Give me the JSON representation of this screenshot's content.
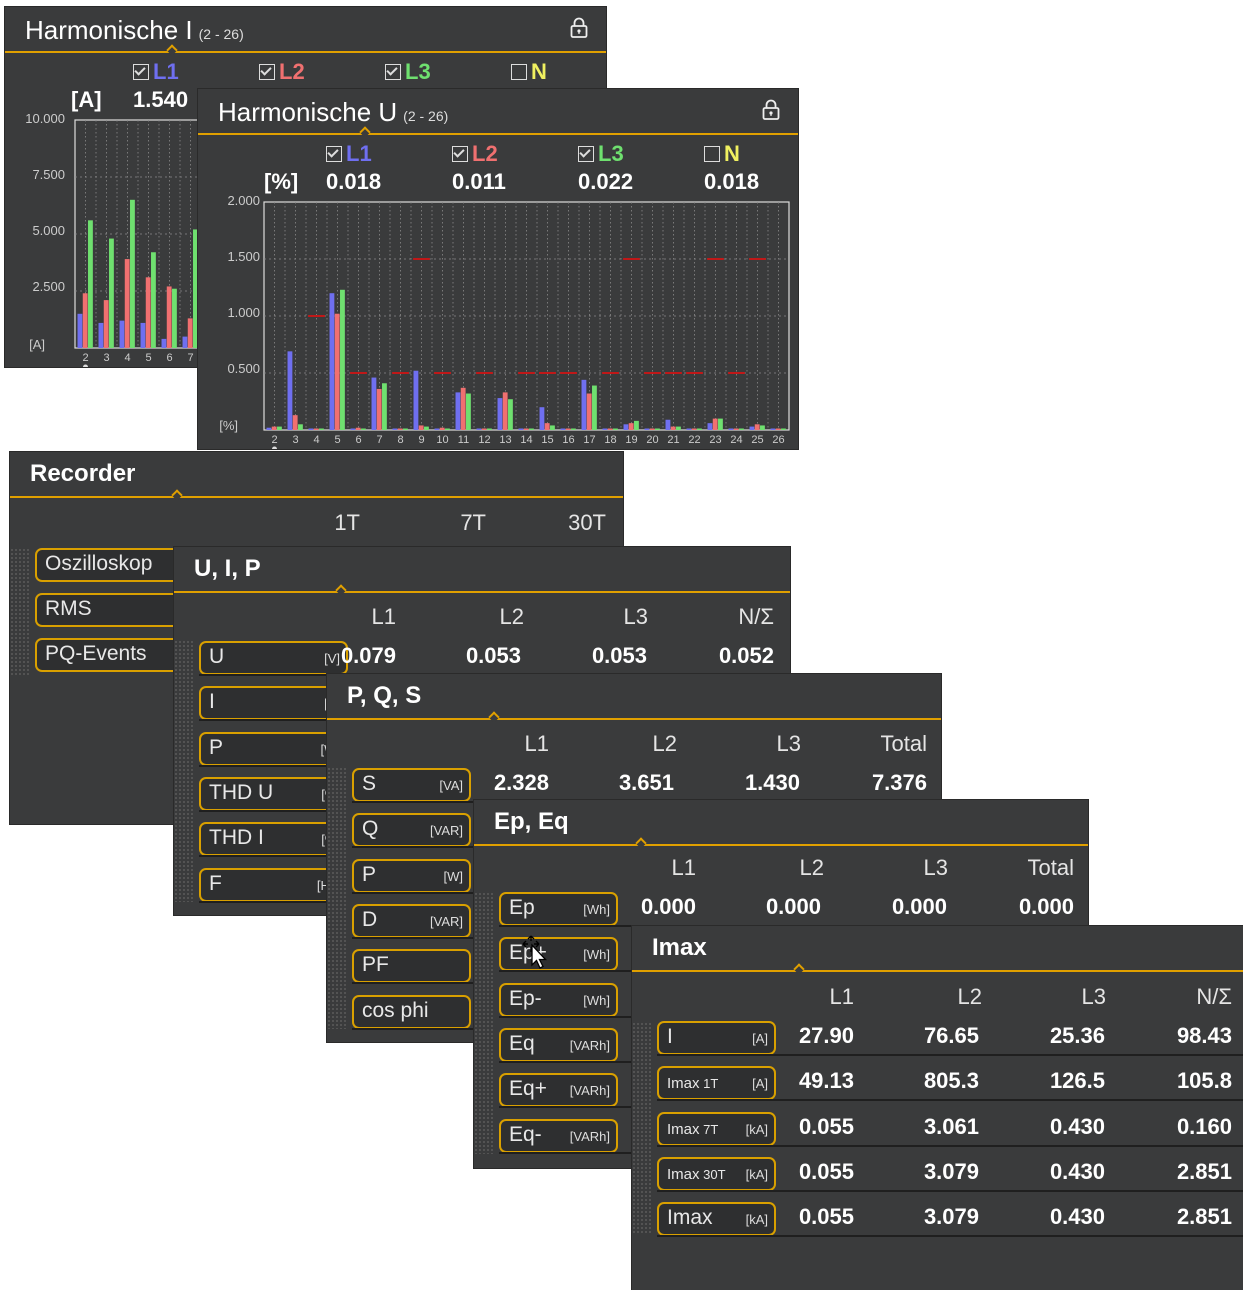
{
  "colors": {
    "L1": "#6f6ff0",
    "L2": "#f07070",
    "L3": "#6fe06f",
    "N": "#f0f060",
    "accent": "#e0a000",
    "limit": "#c01818"
  },
  "harm_i": {
    "title": "Harmonische I",
    "range": "(2 - 26)",
    "unit": "[A]",
    "channels": [
      {
        "name": "L1",
        "checked": true,
        "value": "1.540"
      },
      {
        "name": "L2",
        "checked": true,
        "value": ""
      },
      {
        "name": "L3",
        "checked": true,
        "value": ""
      },
      {
        "name": "N",
        "checked": false,
        "value": ""
      }
    ],
    "yticks": [
      "10.000",
      "7.500",
      "5.000",
      "2.500"
    ],
    "yunit": "[A]",
    "xticks": [
      "2",
      "3",
      "4",
      "5",
      "6",
      "7"
    ]
  },
  "harm_u": {
    "title": "Harmonische U",
    "range": "(2 - 26)",
    "unit": "[%]",
    "channels": [
      {
        "name": "L1",
        "checked": true,
        "value": "0.018"
      },
      {
        "name": "L2",
        "checked": true,
        "value": "0.011"
      },
      {
        "name": "L3",
        "checked": true,
        "value": "0.022"
      },
      {
        "name": "N",
        "checked": false,
        "value": "0.018"
      }
    ],
    "yticks": [
      "2.000",
      "1.500",
      "1.000",
      "0.500"
    ],
    "yunit": "[%]",
    "xticks": [
      "2",
      "3",
      "4",
      "5",
      "6",
      "7",
      "8",
      "9",
      "10",
      "11",
      "12",
      "13",
      "14",
      "15",
      "16",
      "17",
      "18",
      "19",
      "20",
      "21",
      "22",
      "23",
      "24",
      "25",
      "26"
    ]
  },
  "chart_data": [
    {
      "type": "bar",
      "title": "Harmonische I (2 - 26)",
      "ylabel": "[A]",
      "ylim": [
        0,
        10
      ],
      "categories": [
        "2",
        "3",
        "4",
        "5",
        "6",
        "7"
      ],
      "series": [
        {
          "name": "L1",
          "values": [
            1.5,
            1.1,
            1.2,
            1.1,
            0.4,
            0.5
          ]
        },
        {
          "name": "L2",
          "values": [
            2.4,
            2.1,
            3.9,
            3.1,
            2.7,
            1.3
          ]
        },
        {
          "name": "L3",
          "values": [
            5.6,
            4.8,
            6.5,
            4.2,
            2.6,
            5.2
          ]
        }
      ]
    },
    {
      "type": "bar",
      "title": "Harmonische U (2 - 26)",
      "ylabel": "[%]",
      "ylim": [
        0,
        2
      ],
      "categories": [
        "2",
        "3",
        "4",
        "5",
        "6",
        "7",
        "8",
        "9",
        "10",
        "11",
        "12",
        "13",
        "14",
        "15",
        "16",
        "17",
        "18",
        "19",
        "20",
        "21",
        "22",
        "23",
        "24",
        "25",
        "26"
      ],
      "series": [
        {
          "name": "L1",
          "values": [
            0.02,
            0.69,
            0.01,
            1.2,
            0.01,
            0.46,
            0.01,
            0.52,
            0.01,
            0.33,
            0.01,
            0.28,
            0.01,
            0.2,
            0.01,
            0.44,
            0.01,
            0.05,
            0.01,
            0.09,
            0.01,
            0.06,
            0.01,
            0.03,
            0.0
          ]
        },
        {
          "name": "L2",
          "values": [
            0.03,
            0.13,
            0.01,
            1.02,
            0.02,
            0.36,
            0.01,
            0.04,
            0.02,
            0.37,
            0.01,
            0.33,
            0.01,
            0.06,
            0.01,
            0.32,
            0.01,
            0.06,
            0.01,
            0.03,
            0.01,
            0.1,
            0.01,
            0.05,
            0.0
          ]
        },
        {
          "name": "L3",
          "values": [
            0.03,
            0.05,
            0.01,
            1.23,
            0.01,
            0.41,
            0.01,
            0.03,
            0.01,
            0.32,
            0.01,
            0.27,
            0.01,
            0.04,
            0.01,
            0.39,
            0.01,
            0.08,
            0.01,
            0.03,
            0.01,
            0.1,
            0.01,
            0.04,
            0.0
          ]
        }
      ],
      "limits": [
        null,
        null,
        1.0,
        null,
        0.5,
        null,
        0.5,
        1.5,
        0.5,
        null,
        0.5,
        null,
        0.5,
        0.5,
        0.5,
        null,
        0.5,
        1.5,
        0.5,
        0.5,
        0.5,
        1.5,
        0.5,
        1.5,
        null
      ]
    }
  ],
  "recorder": {
    "title": "Recorder",
    "cols": [
      "1T",
      "7T",
      "30T"
    ],
    "items": [
      "Oszilloskop",
      "RMS",
      "PQ-Events"
    ]
  },
  "uip": {
    "title": "U, I, P",
    "cols": [
      "L1",
      "L2",
      "L3",
      "N/Σ"
    ],
    "rows": [
      {
        "name": "U",
        "unit": "[V]",
        "vals": [
          "0.079",
          "0.053",
          "0.053",
          "0.052"
        ]
      },
      {
        "name": "I",
        "unit": "[A]",
        "vals": []
      },
      {
        "name": "P",
        "unit": "[W]",
        "vals": []
      },
      {
        "name": "THD U",
        "unit": "[%]",
        "vals": []
      },
      {
        "name": "THD I",
        "unit": "[%]",
        "vals": []
      },
      {
        "name": "F",
        "unit": "[Hz]",
        "vals": []
      }
    ]
  },
  "pqs": {
    "title": "P, Q, S",
    "cols": [
      "L1",
      "L2",
      "L3",
      "Total"
    ],
    "rows": [
      {
        "name": "S",
        "unit": "[VA]",
        "vals": [
          "2.328",
          "3.651",
          "1.430",
          "7.376"
        ]
      },
      {
        "name": "Q",
        "unit": "[VAR]",
        "vals": []
      },
      {
        "name": "P",
        "unit": "[W]",
        "vals": []
      },
      {
        "name": "D",
        "unit": "[VAR]",
        "vals": []
      },
      {
        "name": "PF",
        "unit": "",
        "vals": []
      },
      {
        "name": "cos phi",
        "unit": "",
        "vals": []
      }
    ]
  },
  "epeq": {
    "title": "Ep, Eq",
    "cols": [
      "L1",
      "L2",
      "L3",
      "Total"
    ],
    "rows": [
      {
        "name": "Ep",
        "unit": "[Wh]",
        "vals": [
          "0.000",
          "0.000",
          "0.000",
          "0.000"
        ]
      },
      {
        "name": "Ep+",
        "unit": "[Wh]",
        "vals": []
      },
      {
        "name": "Ep-",
        "unit": "[Wh]",
        "vals": []
      },
      {
        "name": "Eq",
        "unit": "[VARh]",
        "vals": []
      },
      {
        "name": "Eq+",
        "unit": "[VARh]",
        "vals": []
      },
      {
        "name": "Eq-",
        "unit": "[VARh]",
        "vals": []
      }
    ]
  },
  "imax": {
    "title": "Imax",
    "cols": [
      "L1",
      "L2",
      "L3",
      "N/Σ"
    ],
    "rows": [
      {
        "name": "I",
        "sub": "",
        "unit": "[A]",
        "vals": [
          "27.90",
          "76.65",
          "25.36",
          "98.43"
        ]
      },
      {
        "name": "Imax",
        "sub": " 1T",
        "unit": "[A]",
        "vals": [
          "49.13",
          "805.3",
          "126.5",
          "105.8"
        ]
      },
      {
        "name": "Imax",
        "sub": " 7T",
        "unit": "[kA]",
        "vals": [
          "0.055",
          "3.061",
          "0.430",
          "0.160"
        ]
      },
      {
        "name": "Imax",
        "sub": " 30T",
        "unit": "[kA]",
        "vals": [
          "0.055",
          "3.079",
          "0.430",
          "2.851"
        ]
      },
      {
        "name": "Imax",
        "sub": "",
        "unit": "[kA]",
        "vals": [
          "0.055",
          "3.079",
          "0.430",
          "2.851"
        ]
      }
    ]
  }
}
